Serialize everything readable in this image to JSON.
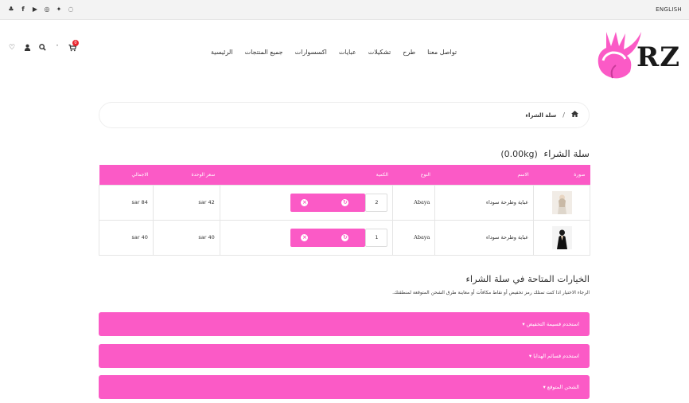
{
  "topbar": {
    "language_link": "ENGLISH",
    "social_icons": [
      "snapchat-icon",
      "facebook-icon",
      "youtube-icon",
      "instagram-icon",
      "twitter-icon",
      "whatsapp-icon"
    ]
  },
  "header": {
    "cart_count": "0",
    "logo_text": "RZ",
    "icons": [
      "cart-icon",
      "chevron-down-icon",
      "search-icon",
      "user-icon",
      "heart-icon"
    ]
  },
  "nav": {
    "items": [
      "الرئيسية",
      "جميع المنتجات",
      "اكسسوارات",
      "عبايات",
      "تشكيلات",
      "طرح",
      "تواصل معنا"
    ]
  },
  "breadcrumb": {
    "current": "سلة الشراء"
  },
  "cart": {
    "title": "سلة الشراء",
    "weight": "(0.00kg)",
    "columns": {
      "image": "صورة",
      "name": "الاسم",
      "type": "النوع",
      "quantity": "الكمية",
      "unit_price": "سعر الوحدة",
      "total": "الاجمالي"
    },
    "rows": [
      {
        "name": "عباية وطرحة سوداء",
        "type": "Abaya",
        "quantity": "2",
        "unit_price": "42 sar",
        "total": "84 sar"
      },
      {
        "name": "عباية وطرحة سوداء",
        "type": "Abaya",
        "quantity": "1",
        "unit_price": "40 sar",
        "total": "40 sar"
      }
    ]
  },
  "options": {
    "title": "الخيارات المتاحة في سلة الشراء",
    "description": "الرجاء الاختيار اذا كنت تمتلك رمز تخفيض أو نقاط مكافآت أو معاينة طرق الشحن المتوقعة لمنطقتك.",
    "panels": [
      "استخدم قسيمة التخفيض ▾",
      "استخدم قسائم الهدايا ▾",
      "الشحن المتوقع ▾"
    ]
  },
  "colors": {
    "accent": "#fb5ac6",
    "badge": "#e8262f"
  }
}
